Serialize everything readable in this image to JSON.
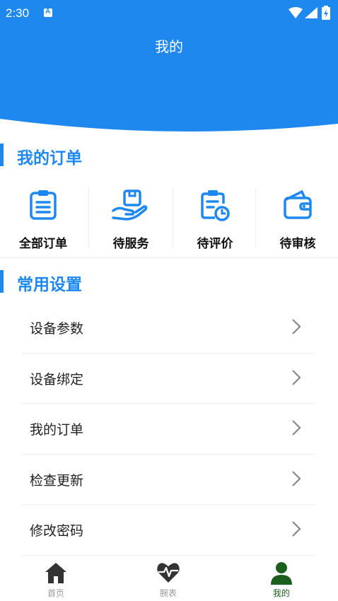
{
  "status": {
    "time": "2:30"
  },
  "header": {
    "title": "我的"
  },
  "orders_section": {
    "title": "我的订单",
    "items": [
      {
        "label": "全部订单",
        "icon": "clipboard-list-icon"
      },
      {
        "label": "待服务",
        "icon": "hand-package-icon"
      },
      {
        "label": "待评价",
        "icon": "clipboard-clock-icon"
      },
      {
        "label": "待审核",
        "icon": "wallet-icon"
      }
    ]
  },
  "settings_section": {
    "title": "常用设置",
    "items": [
      {
        "label": "设备参数"
      },
      {
        "label": "设备绑定"
      },
      {
        "label": "我的订单"
      },
      {
        "label": "检查更新"
      },
      {
        "label": "修改密码"
      }
    ]
  },
  "tabbar": {
    "items": [
      {
        "label": "首页",
        "icon": "home-icon",
        "active": false
      },
      {
        "label": "腕表",
        "icon": "heart-pulse-icon",
        "active": false
      },
      {
        "label": "我的",
        "icon": "person-icon",
        "active": true
      }
    ]
  },
  "colors": {
    "primary": "#1e88ef",
    "active_tab": "#1b5e20",
    "icon_dark": "#333333"
  }
}
